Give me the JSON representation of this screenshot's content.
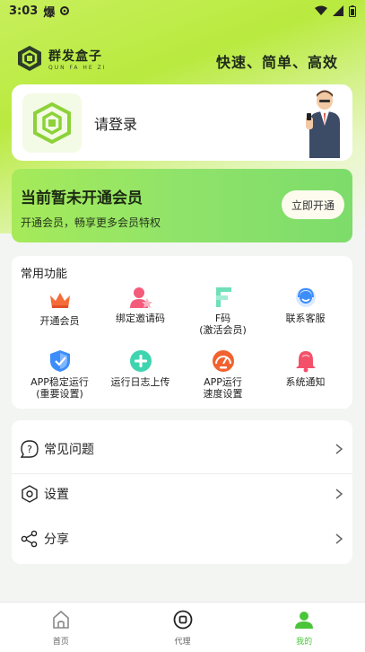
{
  "status_bar": {
    "time": "3:03",
    "app_glyph": "爆"
  },
  "brand": {
    "name": "群发盒子",
    "sub": "QUN FA HE ZI",
    "slogan": "快速、简单、高效"
  },
  "login": {
    "label": "请登录"
  },
  "vip": {
    "title": "当前暂未开通会员",
    "subtitle": "开通会员，畅享更多会员特权",
    "button": "立即开通"
  },
  "functions": {
    "title": "常用功能",
    "items": [
      {
        "label": "开通会员",
        "icon": "crown-icon"
      },
      {
        "label": "绑定邀请码",
        "icon": "user-star-icon"
      },
      {
        "label": "F码\n(激活会员)",
        "icon": "f-code-icon"
      },
      {
        "label": "联系客服",
        "icon": "headset-icon"
      },
      {
        "label": "APP稳定运行\n(重要设置)",
        "icon": "shield-check-icon"
      },
      {
        "label": "运行日志上传",
        "icon": "plus-circle-icon"
      },
      {
        "label": "APP运行\n速度设置",
        "icon": "speedometer-icon"
      },
      {
        "label": "系统通知",
        "icon": "bell-icon"
      }
    ]
  },
  "menu": {
    "items": [
      {
        "label": "常见问题",
        "icon": "question-icon"
      },
      {
        "label": "设置",
        "icon": "hexagon-settings-icon"
      },
      {
        "label": "分享",
        "icon": "share-icon"
      }
    ]
  },
  "tabs": [
    {
      "label": "首页",
      "icon": "home-icon",
      "active": false
    },
    {
      "label": "代理",
      "icon": "circle-square-icon",
      "active": false
    },
    {
      "label": "我的",
      "icon": "person-icon",
      "active": true
    }
  ],
  "colors": {
    "accent": "#4ac53a",
    "brand_green": "#8fe36a",
    "background": "#f3f5f2"
  }
}
